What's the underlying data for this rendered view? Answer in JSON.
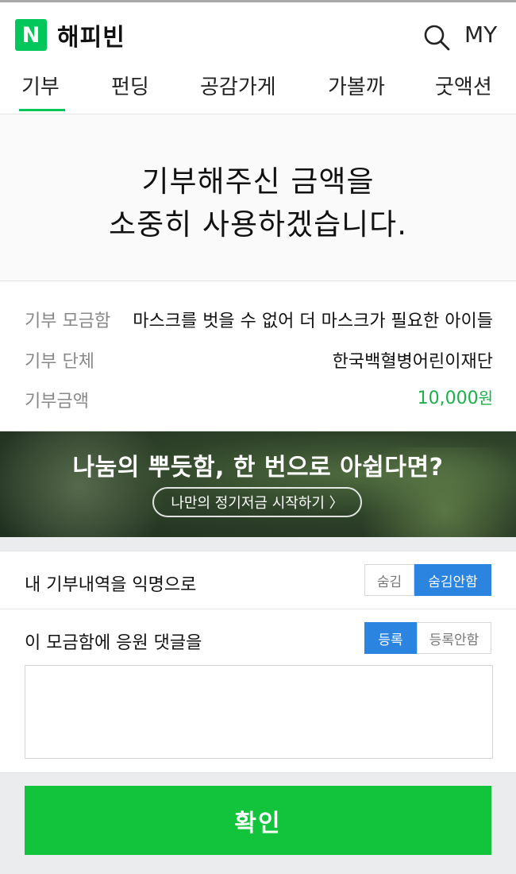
{
  "header": {
    "logo_letter": "N",
    "brand": "해피빈",
    "my_label": "MY"
  },
  "tabs": [
    {
      "label": "기부"
    },
    {
      "label": "펀딩"
    },
    {
      "label": "공감가게"
    },
    {
      "label": "가볼까"
    },
    {
      "label": "굿액션"
    }
  ],
  "thanks": {
    "line1": "기부해주신 금액을",
    "line2": "소중히 사용하겠습니다."
  },
  "info": {
    "fund_label": "기부 모금함",
    "fund_value": "마스크를 벗을 수 없어 더 마스크가 필요한 아이들",
    "org_label": "기부 단체",
    "org_value": "한국백혈병어린이재단",
    "amount_label": "기부금액",
    "amount_value": "10,000",
    "amount_unit": "원"
  },
  "banner": {
    "title": "나눔의 뿌듯함, 한 번으로 아쉽다면?",
    "cta": "나만의 정기저금 시작하기 〉"
  },
  "anonymous": {
    "label": "내 기부내역을 익명으로",
    "option_hide": "숨김",
    "option_show": "숨김안함",
    "selected": "숨김안함"
  },
  "comment": {
    "label": "이 모금함에 응원 댓글을",
    "option_register": "등록",
    "option_no_register": "등록안함",
    "selected": "등록",
    "placeholder": ""
  },
  "confirm_label": "확인",
  "colors": {
    "brand_green": "#03c75a",
    "confirm_green": "#12c43c",
    "selected_blue": "#2b84e0",
    "amount_green": "#1cb04c"
  }
}
